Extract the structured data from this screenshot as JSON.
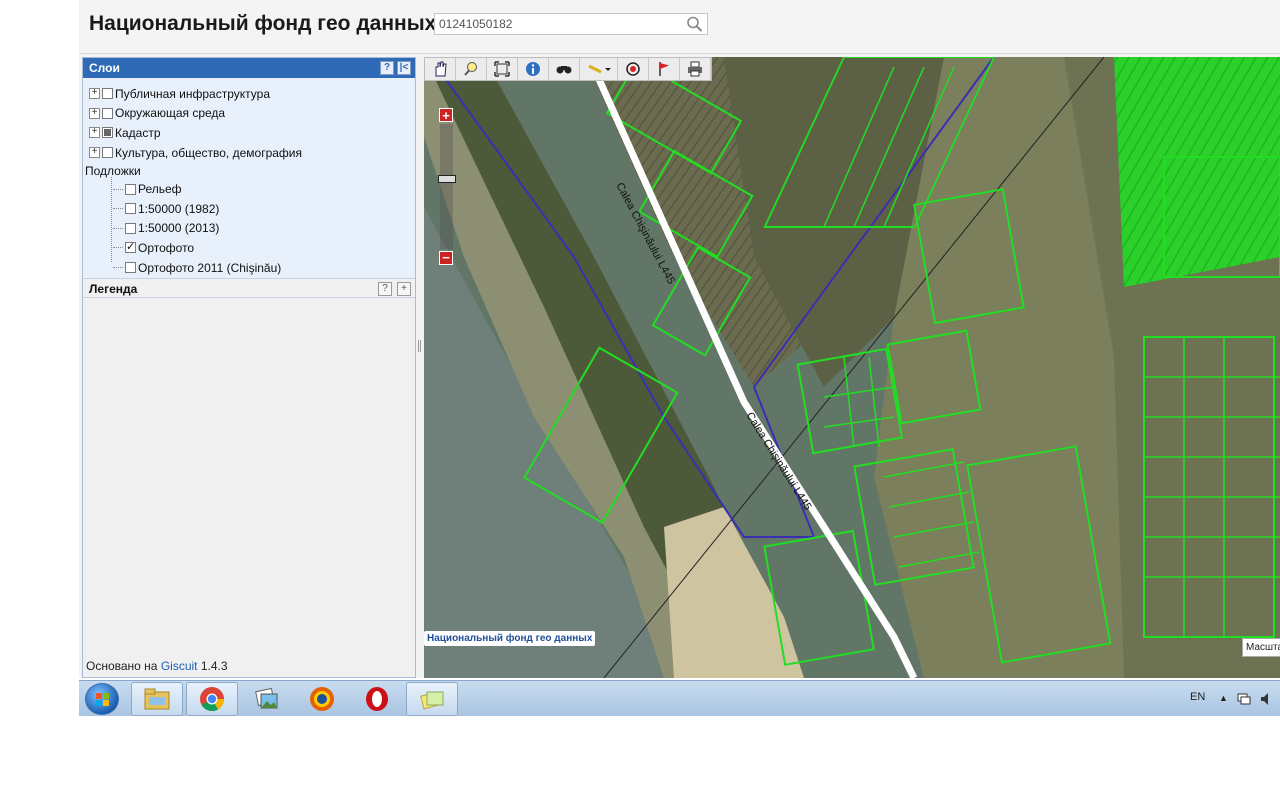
{
  "header": {
    "title": "Национальный фонд гео данных",
    "search_value": "01241050182"
  },
  "layers_panel": {
    "title": "Слои",
    "help_btn": "?",
    "collapse_btn": "|<",
    "groups": [
      {
        "label": "Публичная инфраструктура",
        "state": "unchecked"
      },
      {
        "label": "Окружающая среда",
        "state": "unchecked"
      },
      {
        "label": "Кадастр",
        "state": "partial"
      },
      {
        "label": "Культура, общество, демография",
        "state": "unchecked"
      }
    ],
    "basemaps_label": "Подложки",
    "basemaps": [
      {
        "label": "Рельеф",
        "checked": false
      },
      {
        "label": "1:50000 (1982)",
        "checked": false
      },
      {
        "label": "1:50000 (2013)",
        "checked": false
      },
      {
        "label": "Ортофото",
        "checked": true
      },
      {
        "label": "Ортофото 2011 (Chişinău)",
        "checked": false
      }
    ]
  },
  "legend_panel": {
    "title": "Легенда",
    "help_btn": "?",
    "expand_btn": "+"
  },
  "footer": {
    "prefix": "Основано на",
    "link": "Giscuit",
    "version": "1.4.3"
  },
  "map": {
    "road_label": "Calea Chişinăului L445",
    "attribution": "Национальный фонд гео данных",
    "scale_label": "Масшта",
    "zoom_in": "+",
    "zoom_out": "−",
    "toolbar_icons": [
      "pan-icon",
      "zoom-box-icon",
      "full-extent-icon",
      "info-icon",
      "binoculars-icon",
      "measure-icon",
      "target-icon",
      "flag-icon",
      "print-icon"
    ],
    "colors": {
      "parcel": "#22dd22",
      "boundary": "#3a2fb0",
      "road": "#ffffff"
    }
  },
  "taskbar": {
    "apps": [
      "file-explorer-icon",
      "chrome-icon",
      "photo-viewer-icon",
      "firefox-icon",
      "opera-icon",
      "sticky-notes-icon"
    ],
    "language": "EN"
  }
}
